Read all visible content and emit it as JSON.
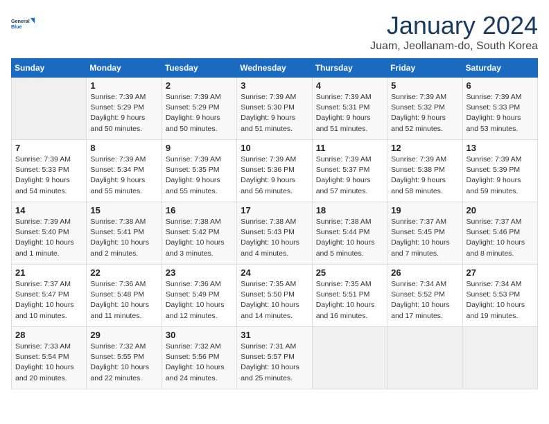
{
  "header": {
    "logo_line1": "General",
    "logo_line2": "Blue",
    "month_title": "January 2024",
    "location": "Juam, Jeollanam-do, South Korea"
  },
  "days_of_week": [
    "Sunday",
    "Monday",
    "Tuesday",
    "Wednesday",
    "Thursday",
    "Friday",
    "Saturday"
  ],
  "weeks": [
    [
      {
        "day": "",
        "info": ""
      },
      {
        "day": "1",
        "info": "Sunrise: 7:39 AM\nSunset: 5:29 PM\nDaylight: 9 hours\nand 50 minutes."
      },
      {
        "day": "2",
        "info": "Sunrise: 7:39 AM\nSunset: 5:29 PM\nDaylight: 9 hours\nand 50 minutes."
      },
      {
        "day": "3",
        "info": "Sunrise: 7:39 AM\nSunset: 5:30 PM\nDaylight: 9 hours\nand 51 minutes."
      },
      {
        "day": "4",
        "info": "Sunrise: 7:39 AM\nSunset: 5:31 PM\nDaylight: 9 hours\nand 51 minutes."
      },
      {
        "day": "5",
        "info": "Sunrise: 7:39 AM\nSunset: 5:32 PM\nDaylight: 9 hours\nand 52 minutes."
      },
      {
        "day": "6",
        "info": "Sunrise: 7:39 AM\nSunset: 5:33 PM\nDaylight: 9 hours\nand 53 minutes."
      }
    ],
    [
      {
        "day": "7",
        "info": "Sunrise: 7:39 AM\nSunset: 5:33 PM\nDaylight: 9 hours\nand 54 minutes."
      },
      {
        "day": "8",
        "info": "Sunrise: 7:39 AM\nSunset: 5:34 PM\nDaylight: 9 hours\nand 55 minutes."
      },
      {
        "day": "9",
        "info": "Sunrise: 7:39 AM\nSunset: 5:35 PM\nDaylight: 9 hours\nand 55 minutes."
      },
      {
        "day": "10",
        "info": "Sunrise: 7:39 AM\nSunset: 5:36 PM\nDaylight: 9 hours\nand 56 minutes."
      },
      {
        "day": "11",
        "info": "Sunrise: 7:39 AM\nSunset: 5:37 PM\nDaylight: 9 hours\nand 57 minutes."
      },
      {
        "day": "12",
        "info": "Sunrise: 7:39 AM\nSunset: 5:38 PM\nDaylight: 9 hours\nand 58 minutes."
      },
      {
        "day": "13",
        "info": "Sunrise: 7:39 AM\nSunset: 5:39 PM\nDaylight: 9 hours\nand 59 minutes."
      }
    ],
    [
      {
        "day": "14",
        "info": "Sunrise: 7:39 AM\nSunset: 5:40 PM\nDaylight: 10 hours\nand 1 minute."
      },
      {
        "day": "15",
        "info": "Sunrise: 7:38 AM\nSunset: 5:41 PM\nDaylight: 10 hours\nand 2 minutes."
      },
      {
        "day": "16",
        "info": "Sunrise: 7:38 AM\nSunset: 5:42 PM\nDaylight: 10 hours\nand 3 minutes."
      },
      {
        "day": "17",
        "info": "Sunrise: 7:38 AM\nSunset: 5:43 PM\nDaylight: 10 hours\nand 4 minutes."
      },
      {
        "day": "18",
        "info": "Sunrise: 7:38 AM\nSunset: 5:44 PM\nDaylight: 10 hours\nand 5 minutes."
      },
      {
        "day": "19",
        "info": "Sunrise: 7:37 AM\nSunset: 5:45 PM\nDaylight: 10 hours\nand 7 minutes."
      },
      {
        "day": "20",
        "info": "Sunrise: 7:37 AM\nSunset: 5:46 PM\nDaylight: 10 hours\nand 8 minutes."
      }
    ],
    [
      {
        "day": "21",
        "info": "Sunrise: 7:37 AM\nSunset: 5:47 PM\nDaylight: 10 hours\nand 10 minutes."
      },
      {
        "day": "22",
        "info": "Sunrise: 7:36 AM\nSunset: 5:48 PM\nDaylight: 10 hours\nand 11 minutes."
      },
      {
        "day": "23",
        "info": "Sunrise: 7:36 AM\nSunset: 5:49 PM\nDaylight: 10 hours\nand 12 minutes."
      },
      {
        "day": "24",
        "info": "Sunrise: 7:35 AM\nSunset: 5:50 PM\nDaylight: 10 hours\nand 14 minutes."
      },
      {
        "day": "25",
        "info": "Sunrise: 7:35 AM\nSunset: 5:51 PM\nDaylight: 10 hours\nand 16 minutes."
      },
      {
        "day": "26",
        "info": "Sunrise: 7:34 AM\nSunset: 5:52 PM\nDaylight: 10 hours\nand 17 minutes."
      },
      {
        "day": "27",
        "info": "Sunrise: 7:34 AM\nSunset: 5:53 PM\nDaylight: 10 hours\nand 19 minutes."
      }
    ],
    [
      {
        "day": "28",
        "info": "Sunrise: 7:33 AM\nSunset: 5:54 PM\nDaylight: 10 hours\nand 20 minutes."
      },
      {
        "day": "29",
        "info": "Sunrise: 7:32 AM\nSunset: 5:55 PM\nDaylight: 10 hours\nand 22 minutes."
      },
      {
        "day": "30",
        "info": "Sunrise: 7:32 AM\nSunset: 5:56 PM\nDaylight: 10 hours\nand 24 minutes."
      },
      {
        "day": "31",
        "info": "Sunrise: 7:31 AM\nSunset: 5:57 PM\nDaylight: 10 hours\nand 25 minutes."
      },
      {
        "day": "",
        "info": ""
      },
      {
        "day": "",
        "info": ""
      },
      {
        "day": "",
        "info": ""
      }
    ]
  ]
}
